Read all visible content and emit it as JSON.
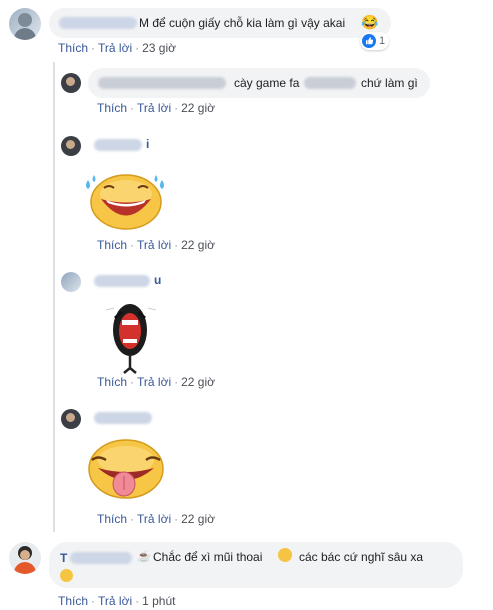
{
  "comments": [
    {
      "text_pre": "M để cuộn giấy chỗ kia làm gì vậy akai",
      "emoji": "😂",
      "reaction_count": "1",
      "actions": {
        "like": "Thích",
        "reply": "Trả lời",
        "time": "23 giờ"
      }
    },
    {
      "text_a": "cày game fa",
      "text_b": "chứ làm gì",
      "actions": {
        "like": "Thích",
        "reply": "Trả lời",
        "time": "22 giờ"
      }
    },
    {
      "name_tail": "i",
      "actions": {
        "like": "Thích",
        "reply": "Trả lời",
        "time": "22 giờ"
      }
    },
    {
      "name_tail": "u",
      "actions": {
        "like": "Thích",
        "reply": "Trả lời",
        "time": "22 giờ"
      }
    },
    {
      "actions": {
        "like": "Thích",
        "reply": "Trả lời",
        "time": "22 giờ"
      }
    },
    {
      "name_prefix": "T",
      "text_pre": "Chắc để xì mũi thoai",
      "text_post": "các bác cứ nghĩ sâu xa",
      "actions": {
        "like": "Thích",
        "reply": "Trả lời",
        "time": "1 phút"
      }
    }
  ],
  "icons": {
    "like_reaction": "like-icon",
    "tears_sticker": "laughing-tears-sticker",
    "screaming_sticker": "screaming-face-sticker",
    "tongue_sticker": "tongue-out-sticker"
  },
  "colors": {
    "link": "#385898",
    "bubble": "#f2f3f5",
    "like_blue": "#1877f2"
  }
}
